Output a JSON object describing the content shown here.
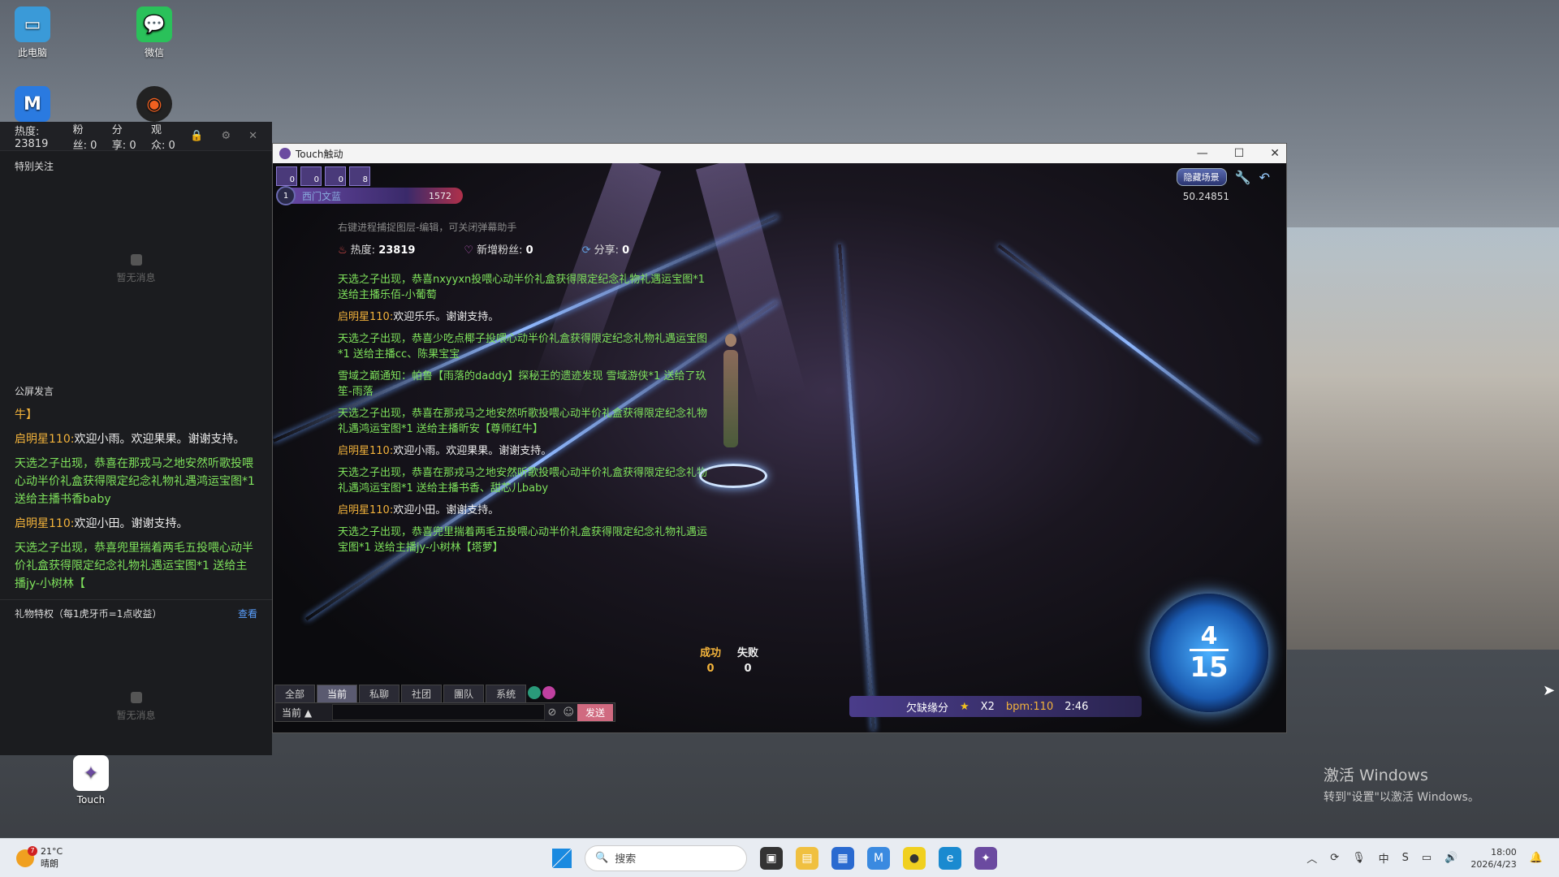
{
  "desktop": {
    "icons": [
      {
        "label": "此电脑"
      },
      {
        "label": "微信"
      },
      {
        "label": "Touch"
      }
    ],
    "activation": {
      "title": "激活 Windows",
      "subtitle": "转到\"设置\"以激活 Windows。"
    }
  },
  "assistant_panel": {
    "stats": {
      "heat_label": "热度:",
      "heat": "23819",
      "fans_label": "粉丝:",
      "fans": "0",
      "share_label": "分享:",
      "share": "0",
      "viewers_label": "观众:",
      "viewers": "0"
    },
    "special_follow_title": "特别关注",
    "empty_text": "暂无消息",
    "public_chat_title": "公屏发言",
    "messages": [
      {
        "text": "牛】",
        "color": "yellow"
      },
      {
        "name": "启明星110:",
        "text": "欢迎小雨。欢迎果果。谢谢支持。"
      },
      {
        "text": "天选之子出现，恭喜在那戎马之地安然听歌投喂心动半价礼盒获得限定纪念礼物礼遇鸿运宝图*1 送给主播书香baby",
        "color": "green"
      },
      {
        "name": "启明星110:",
        "text": "欢迎小田。谢谢支持。"
      },
      {
        "text": "天选之子出现，恭喜兜里揣着两毛五投喂心动半价礼盒获得限定纪念礼物礼遇运宝图*1 送给主播jy-小树林【",
        "color": "green"
      }
    ],
    "gift_title": "礼物特权（每1虎牙币=1点收益）",
    "gift_link": "查看",
    "empty_text2": "暂无消息"
  },
  "game_window": {
    "title": "Touch触动",
    "player": {
      "level": "1",
      "name": "西门文蓝",
      "score": "1572"
    },
    "badges": [
      "0",
      "0",
      "0",
      "8"
    ],
    "hint": "右键进程捕捉图层-编辑，可关闭弹幕助手",
    "stats": {
      "heat_label": "热度:",
      "heat": "23819",
      "fans_label": "新增粉丝:",
      "fans": "0",
      "share_label": "分享:",
      "share": "0"
    },
    "hide_scene": "隐藏场景",
    "coord": "50.24851",
    "chat": [
      {
        "text": "天选之子出现，恭喜nxyyxn投喂心动半价礼盒获得限定纪念礼物礼遇运宝图*1 送给主播乐佰-小葡萄",
        "color": "green"
      },
      {
        "name": "启明星110:",
        "text": "欢迎乐乐。谢谢支持。"
      },
      {
        "text": "天选之子出现，恭喜少吃点椰子投喂心动半价礼盒获得限定纪念礼物礼遇运宝图*1 送给主播cc、陈果宝宝",
        "color": "green"
      },
      {
        "text": "雪域之巅通知：帕鲁【雨落的daddy】探秘王的遗迹发现 雪域游侠*1 送给了玖笙-雨落",
        "color": "green"
      },
      {
        "text": "天选之子出现，恭喜在那戎马之地安然听歌投喂心动半价礼盒获得限定纪念礼物礼遇鸿运宝图*1 送给主播昕安【尊师红牛】",
        "color": "green"
      },
      {
        "name": "启明星110:",
        "text": "欢迎小雨。欢迎果果。谢谢支持。"
      },
      {
        "text": "天选之子出现，恭喜在那戎马之地安然听歌投喂心动半价礼盒获得限定纪念礼物礼遇鸿运宝图*1 送给主播书香、甜芯儿baby",
        "color": "green"
      },
      {
        "name": "启明星110:",
        "text": "欢迎小田。谢谢支持。"
      },
      {
        "text": "天选之子出现，恭喜兜里揣着两毛五投喂心动半价礼盒获得限定纪念礼物礼遇运宝图*1 送给主播jy-小树林【塔萝】",
        "color": "green"
      }
    ],
    "result": {
      "success_label": "成功",
      "success": "0",
      "fail_label": "失败",
      "fail": "0"
    },
    "song": {
      "name": "欠缺缘分",
      "multiplier": "X2",
      "bpm": "bpm:110",
      "time": "2:46"
    },
    "combo": {
      "current": "4",
      "total": "15"
    },
    "chat_tabs": [
      "全部",
      "当前",
      "私聊",
      "社团",
      "團队",
      "系统"
    ],
    "chat_scope": "当前",
    "send_label": "发送"
  },
  "taskbar": {
    "weather": {
      "temp": "21°C",
      "desc": "晴朗",
      "badge": "7"
    },
    "search_placeholder": "搜索",
    "time": "18:00",
    "date": "2026/4/23"
  }
}
